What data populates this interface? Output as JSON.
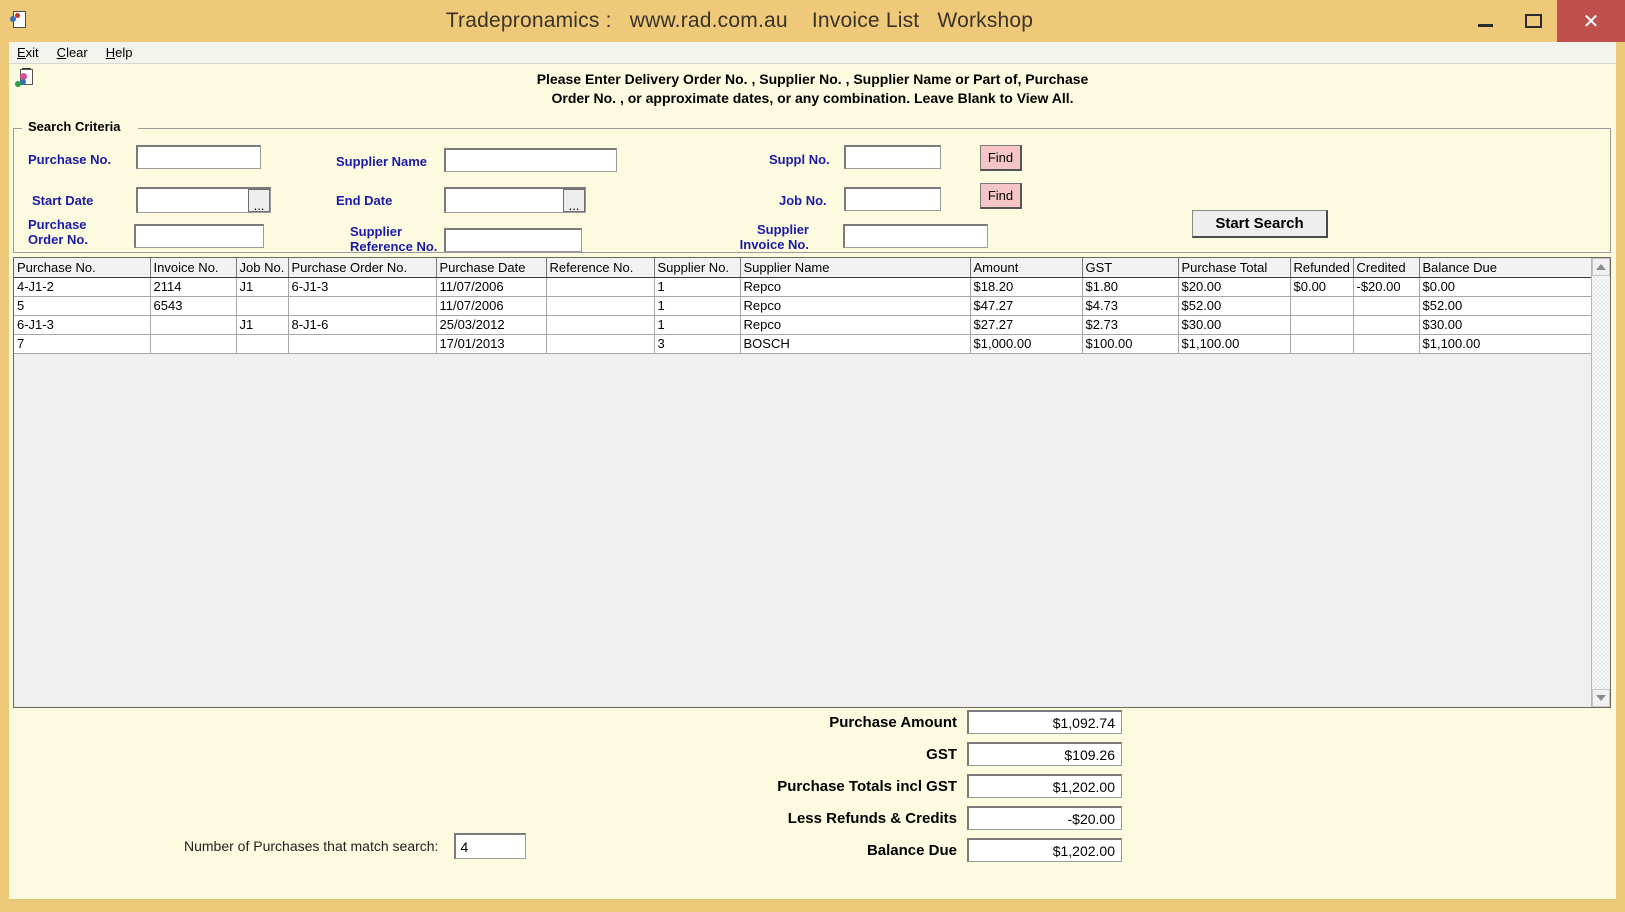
{
  "window": {
    "title": "Tradepronamics :   www.rad.com.au    Invoice List   Workshop",
    "icon": "document-icon",
    "minimize_label": "",
    "maximize_label": "",
    "close_label": "✕",
    "titlebar_color": "#eec97a",
    "close_color": "#c0504d",
    "client_color": "#fdfbdf"
  },
  "menu": {
    "items": [
      {
        "label": "Exit",
        "accel": "E",
        "rest": "xit"
      },
      {
        "label": "Clear",
        "accel": "C",
        "rest": "lear"
      },
      {
        "label": "Help",
        "accel": "H",
        "rest": "elp"
      }
    ]
  },
  "instructions": {
    "line1": "Please Enter Delivery Order No. , Supplier No. , Supplier Name or Part of, Purchase",
    "line2": "Order No. , or approximate dates, or any combination. Leave Blank to View All."
  },
  "search": {
    "legend": "Search Criteria",
    "label_color": "#1a1aa8",
    "fields": {
      "purchase_no": {
        "label": "Purchase No.",
        "value": "",
        "placeholder": ""
      },
      "supplier_name": {
        "label": "Supplier Name",
        "value": "",
        "placeholder": ""
      },
      "suppl_no": {
        "label": "Suppl No.",
        "value": "",
        "placeholder": ""
      },
      "start_date": {
        "label": "Start Date",
        "value": "",
        "placeholder": "",
        "button_label": "..."
      },
      "end_date": {
        "label": "End Date",
        "value": "",
        "placeholder": "",
        "button_label": "..."
      },
      "job_no": {
        "label": "Job No.",
        "value": "",
        "placeholder": ""
      },
      "purchase_order_no": {
        "label_line1": "Purchase",
        "label_line2": "Order No.",
        "value": "",
        "placeholder": ""
      },
      "supplier_reference_no": {
        "label_line1": "Supplier",
        "label_line2": "Reference No.",
        "value": "",
        "placeholder": ""
      },
      "supplier_invoice_no": {
        "label_line1": "Supplier",
        "label_line2": "Invoice No.",
        "value": "",
        "placeholder": ""
      }
    },
    "find_supplier_label": "Find",
    "find_job_label": "Find",
    "start_search_label": "Start Search"
  },
  "grid": {
    "columns": [
      "Purchase No.",
      "Invoice No.",
      "Job No.",
      "Purchase Order No.",
      "Purchase Date",
      "Reference No.",
      "Supplier No.",
      "Supplier Name",
      "Amount",
      "GST",
      "Purchase Total",
      "Refunded",
      "Credited",
      "Balance Due"
    ],
    "rows": [
      [
        "4-J1-2",
        "2114",
        "J1",
        "6-J1-3",
        "11/07/2006",
        "",
        "1",
        "Repco",
        "$18.20",
        "$1.80",
        "$20.00",
        "$0.00",
        "-$20.00",
        "$0.00"
      ],
      [
        "5",
        "6543",
        "",
        "",
        "11/07/2006",
        "",
        "1",
        "Repco",
        "$47.27",
        "$4.73",
        "$52.00",
        "",
        "",
        "$52.00"
      ],
      [
        "6-J1-3",
        "",
        "J1",
        "8-J1-6",
        "25/03/2012",
        "",
        "1",
        "Repco",
        "$27.27",
        "$2.73",
        "$30.00",
        "",
        "",
        "$30.00"
      ],
      [
        "7",
        "",
        "",
        "",
        "17/01/2013",
        "",
        "3",
        "BOSCH",
        "$1,000.00",
        "$100.00",
        "$1,100.00",
        "",
        "",
        "$1,100.00"
      ]
    ]
  },
  "totals": {
    "rows": [
      {
        "label": "Purchase Amount",
        "value": "$1,092.74"
      },
      {
        "label": "GST",
        "value": "$109.26"
      },
      {
        "label": "Purchase Totals incl GST",
        "value": "$1,202.00"
      },
      {
        "label": "Less Refunds & Credits",
        "value": "-$20.00"
      },
      {
        "label": "Balance Due",
        "value": "$1,202.00"
      }
    ]
  },
  "match_count": {
    "label": "Number of Purchases that match search:",
    "value": "4"
  }
}
